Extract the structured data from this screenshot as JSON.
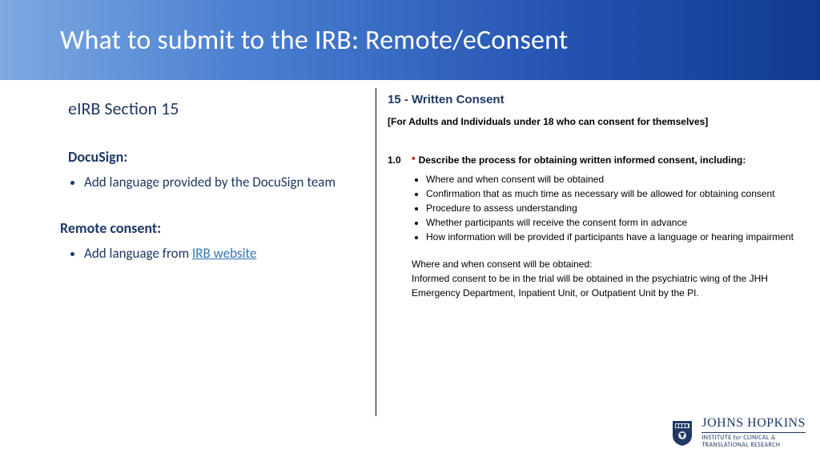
{
  "header": {
    "title": "What to submit to the IRB: Remote/eConsent"
  },
  "left": {
    "section_title": "eIRB Section 15",
    "docusign": {
      "heading": "DocuSign:",
      "bullet": "Add language provided by the DocuSign team"
    },
    "remote": {
      "heading": "Remote consent:",
      "bullet_prefix": "Add language from ",
      "link_text": "IRB website"
    }
  },
  "right": {
    "title": "15 - Written Consent",
    "subtitle": "[For Adults and Individuals under 18 who can consent for themselves]",
    "item_number": "1.0",
    "star": "*",
    "question": "Describe the process for obtaining written informed consent, including:",
    "sub_bullets": [
      "Where and when consent will be obtained",
      "Confirmation that as much time as necessary will be allowed for obtaining consent",
      "Procedure to assess understanding",
      "Whether participants will receive the consent form in advance",
      "How information will be provided if participants have a language or hearing impairment"
    ],
    "para1": "Where and when consent will be obtained:",
    "para2": "Informed consent to be in the trial will be obtained in the psychiatric wing of the JHH Emergency Department, Inpatient Unit, or Outpatient Unit by the PI."
  },
  "footer": {
    "name": "JOHNS HOPKINS",
    "line1a": "INSTITUTE ",
    "line1b": "for",
    "line1c": " CLINICAL ",
    "line1d": "&",
    "line2": "TRANSLATIONAL RESEARCH"
  }
}
